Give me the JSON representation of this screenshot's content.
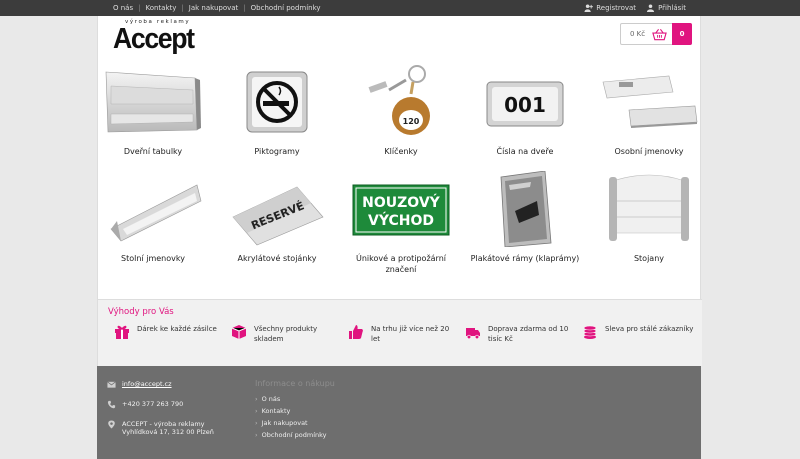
{
  "topbar": {
    "links": [
      "O nás",
      "Kontakty",
      "Jak nakupovat",
      "Obchodní podmínky"
    ],
    "register": "Registrovat",
    "login": "Přihlásit"
  },
  "logo": {
    "text": "Accept",
    "tagline": "výroba reklamy"
  },
  "cart": {
    "amount": "0 Kč",
    "count": "0"
  },
  "categories": [
    {
      "label": "Dveřní tabulky",
      "icon": "door-sign"
    },
    {
      "label": "Piktogramy",
      "icon": "no-smoking-pictogram"
    },
    {
      "label": "Klíčenky",
      "icon": "keychain",
      "tag": "120"
    },
    {
      "label": "Čísla na dveře",
      "icon": "door-number",
      "tag": "001"
    },
    {
      "label": "Osobní jmenovky",
      "icon": "name-badge"
    },
    {
      "label": "Stolní jmenovky",
      "icon": "table-name-tent"
    },
    {
      "label": "Akrylátové stojánky",
      "icon": "acrylic-stand",
      "tag": "RESERVÉ"
    },
    {
      "label": "Únikové a protipožární značení",
      "icon": "emergency-exit-sign",
      "tag1": "NOUZOVÝ",
      "tag2": "VÝCHOD"
    },
    {
      "label": "Plakátové rámy (klaprámy)",
      "icon": "poster-frame"
    },
    {
      "label": "Stojany",
      "icon": "stand"
    }
  ],
  "benefits": {
    "title": "Výhody pro Vás",
    "items": [
      {
        "text": "Dárek ke každé zásilce",
        "icon": "gift-icon"
      },
      {
        "text": "Všechny produkty skladem",
        "icon": "box-icon"
      },
      {
        "text": "Na trhu již více než 20 let",
        "icon": "thumbs-up-icon"
      },
      {
        "text": "Doprava zdarma od 10 tisíc Kč",
        "icon": "truck-icon"
      },
      {
        "text": "Sleva pro stálé zákazníky",
        "icon": "coins-icon"
      }
    ]
  },
  "footer": {
    "email": "info@accept.cz",
    "phone": "+420 377 263 790",
    "address1": "ACCEPT - výroba reklamy",
    "address2": "Vyhlídková 17, 312 00 Plzeň",
    "info_title": "Informace o nákupu",
    "info_links": [
      "O nás",
      "Kontakty",
      "Jak nakupovat",
      "Obchodní podmínky"
    ]
  },
  "colors": {
    "accent": "#e0147f",
    "topbar": "#3c3c3c",
    "footer": "#6e6e6e",
    "exit_green": "#1e8a3a"
  }
}
